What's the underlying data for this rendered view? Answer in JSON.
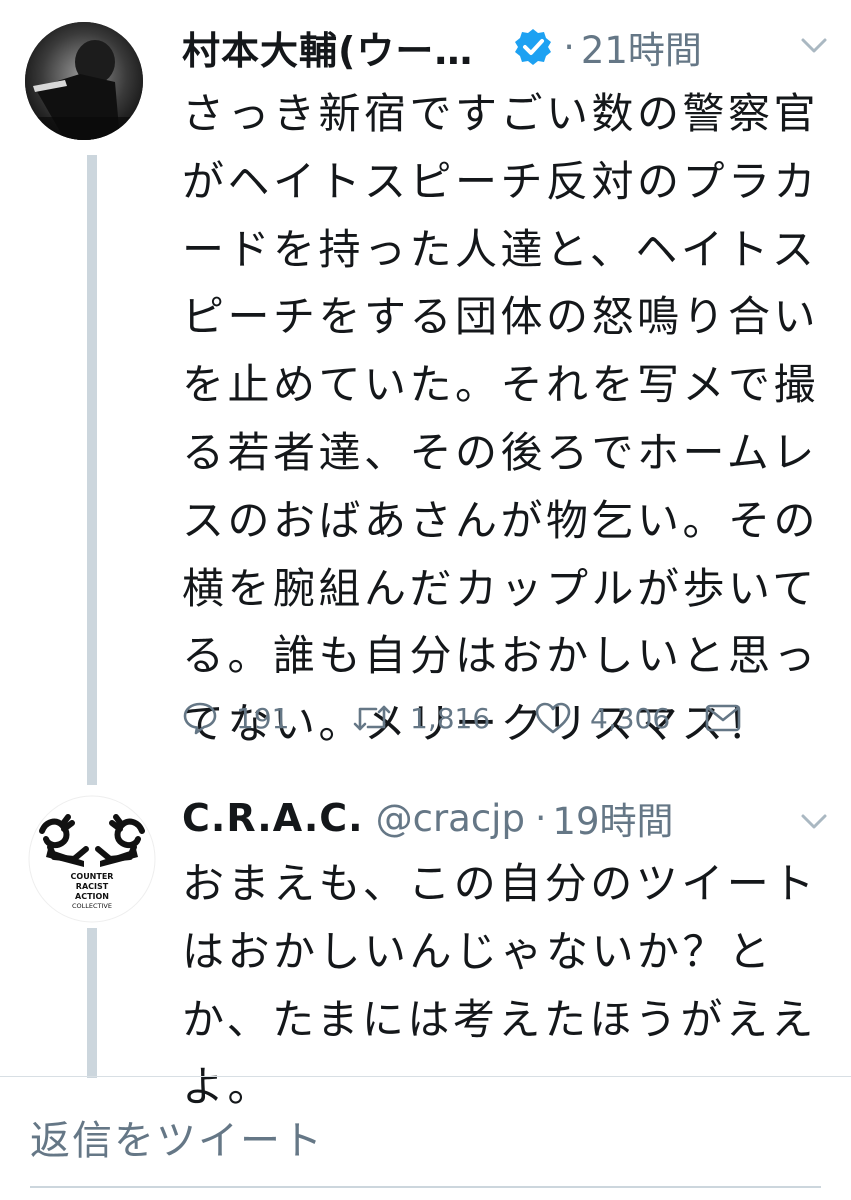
{
  "tweets": [
    {
      "display_name": "村本大輔(ウー…",
      "verified": true,
      "separator": "·",
      "time": "21時間",
      "text": "さっき新宿ですごい数の警察官がヘイトスピーチ反対のプラカードを持った人達と、ヘイトスピーチをする団体の怒鳴り合いを止めていた。それを写メで撮る若者達、その後ろでホームレスのおばあさんが物乞い。その横を腕組んだカップルが歩いてる。誰も自分はおかしいと思ってない。メリークリスマス！",
      "actions": {
        "replies": "191",
        "retweets": "1,816",
        "likes": "4,306"
      },
      "avatar_icon": "profile-photo-icon"
    },
    {
      "display_name": "C.R.A.C.",
      "handle": "@cracjp",
      "separator": "·",
      "time": "19時間",
      "text": "おまえも、この自分のツイートはおかしいんじゃないか？とか、たまには考えたほうがええよ。",
      "avatar_text": [
        "COUNTER",
        "RACIST",
        "ACTION",
        "COLLECTIVE"
      ],
      "avatar_icon": "crac-logo-icon"
    }
  ],
  "compose": {
    "placeholder": "返信をツイート"
  },
  "colors": {
    "text": "#14171a",
    "secondary": "#657786",
    "verified": "#1da1f2",
    "thread_line": "#ccd6dd"
  }
}
